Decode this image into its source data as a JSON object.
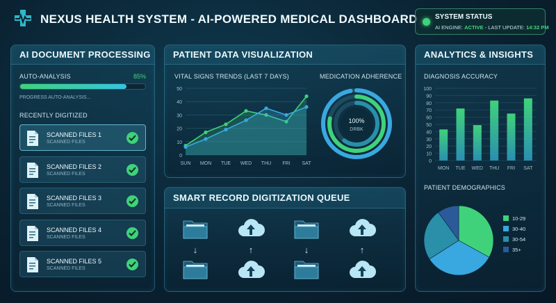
{
  "header": {
    "title": "NEXUS HEALTH SYSTEM - AI-POWERED MEDICAL DASHBOARD",
    "logo_icon": "medical-cross-pulse-icon"
  },
  "status": {
    "title": "SYSTEM STATUS",
    "engine_prefix": "AI ENGINE:",
    "engine_state": "ACTIVE",
    "update_prefix": "- LAST UPDATE:",
    "update_time": "14:32 PM"
  },
  "doc_panel": {
    "title": "AI DOCUMENT PROCESSING",
    "auto_label": "AUTO-ANALYSIS",
    "auto_percent_text": "85%",
    "auto_progress": 0.85,
    "progress_caption": "PROGRESS AUTO-ANALYSIS...",
    "recent_label": "RECENTLY DIGITIZED",
    "items": [
      {
        "name": "SCANNED FILES 1",
        "sub": "SCANNED FILES"
      },
      {
        "name": "SCANNED FILES 2",
        "sub": "SCANNED FILES"
      },
      {
        "name": "SCANNED FILES 3",
        "sub": "SCANNED FILES"
      },
      {
        "name": "SCANNED FILES 4",
        "sub": "SCANNED FILES"
      },
      {
        "name": "SCANNED FILES 5",
        "sub": "SCANNED FILES"
      }
    ]
  },
  "patient_panel": {
    "title": "PATIENT DATA VISUALIZATION",
    "vitals_label": "VITAL SIGNS TRENDS (LAST 7 DAYS)",
    "adherence_label": "MEDICATION ADHERENCE",
    "adherence_value": "100%",
    "adherence_caption": "DRBK",
    "adherence_rings": [
      0.97,
      0.78,
      0.6
    ]
  },
  "queue_panel": {
    "title": "SMART RECORD DIGITIZATION QUEUE",
    "columns": [
      {
        "top": "folder-icon",
        "arrow": "↓",
        "bottom": "folder-icon"
      },
      {
        "top": "cloud-upload-icon",
        "arrow": "↑",
        "bottom": "cloud-upload-icon"
      },
      {
        "top": "folder-icon",
        "arrow": "↓",
        "bottom": "folder-icon"
      },
      {
        "top": "cloud-upload-icon",
        "arrow": "↑",
        "bottom": "cloud-upload-icon"
      }
    ]
  },
  "analytics_panel": {
    "title": "ANALYTICS & INSIGHTS",
    "accuracy_label": "DIAGNOSIS ACCURACY",
    "demographics_label": "PATIENT DEMOGRAPHICS"
  },
  "colors": {
    "accent_green": "#3fd27a",
    "accent_blue": "#3aa8e0",
    "accent_teal": "#2a8fa8",
    "accent_navy": "#2a5a9a"
  },
  "chart_data": [
    {
      "type": "area",
      "title": "VITAL SIGNS TRENDS (LAST 7 DAYS)",
      "categories": [
        "SUN",
        "MON",
        "TUE",
        "WED",
        "THU",
        "FRI",
        "SAT"
      ],
      "ylim": [
        0,
        50
      ],
      "yticks": [
        0,
        10,
        20,
        30,
        40,
        50
      ],
      "series": [
        {
          "values": [
            7,
            17,
            23,
            33,
            30,
            25,
            44
          ]
        },
        {
          "values": [
            6,
            12,
            19,
            26,
            35,
            30,
            36
          ]
        }
      ]
    },
    {
      "type": "bar",
      "title": "DIAGNOSIS ACCURACY",
      "categories": [
        "MON",
        "TUE",
        "WED",
        "THU",
        "FRI",
        "SAT"
      ],
      "ylim": [
        0,
        100
      ],
      "yticks": [
        0,
        10,
        20,
        30,
        40,
        50,
        60,
        70,
        80,
        90,
        100
      ],
      "values": [
        43,
        72,
        49,
        83,
        65,
        86
      ]
    },
    {
      "type": "pie",
      "title": "PATIENT DEMOGRAPHICS",
      "categories": [
        "10-29",
        "30-40",
        "30-54",
        "35+"
      ],
      "values": [
        33,
        33,
        24,
        10
      ],
      "colors": [
        "#3fd27a",
        "#3aa8e0",
        "#2a8fa8",
        "#2a5a9a"
      ]
    }
  ]
}
